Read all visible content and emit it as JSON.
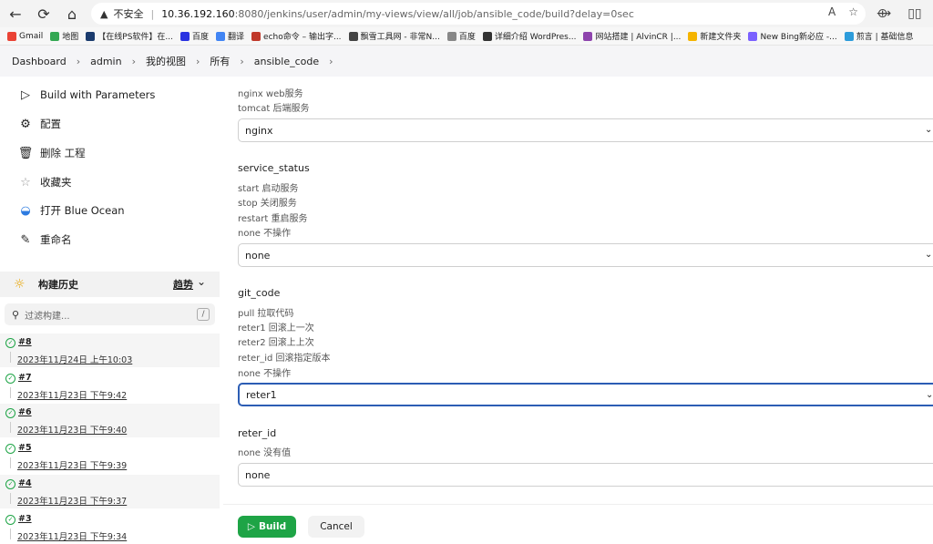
{
  "browser": {
    "back": "←",
    "reload": "⟳",
    "home": "⌂",
    "insecure_label": "不安全",
    "url_host": "10.36.192.160",
    "url_rest": ":8080/jenkins/user/admin/my-views/view/all/job/ansible_code/build?delay=0sec",
    "read_aloud": "A",
    "favorite": "☆",
    "extensions": "⟴",
    "split": "▯▯"
  },
  "bookmarks": [
    {
      "label": "Gmail",
      "color": "#ea4335"
    },
    {
      "label": "地图",
      "color": "#34a853"
    },
    {
      "label": "【在线PS软件】在...",
      "color": "#1b3c6e"
    },
    {
      "label": "百度",
      "color": "#2932e1"
    },
    {
      "label": "翻译",
      "color": "#4285f4"
    },
    {
      "label": "echo命令 – 输出字...",
      "color": "#c0392b"
    },
    {
      "label": "飘雪工具网 - 非常N...",
      "color": "#444444"
    },
    {
      "label": "百度",
      "color": "#888888"
    },
    {
      "label": "详细介绍 WordPres...",
      "color": "#333333"
    },
    {
      "label": "网站搭建 | AlvinCR |...",
      "color": "#8e44ad"
    },
    {
      "label": "新建文件夹",
      "color": "#f5b400"
    },
    {
      "label": "New Bing新必应 -...",
      "color": "#7b61ff"
    },
    {
      "label": "煎言 | 基础信息",
      "color": "#2d9cdb"
    }
  ],
  "breadcrumb": [
    "Dashboard",
    "admin",
    "我的视图",
    "所有",
    "ansible_code"
  ],
  "sidebar": {
    "tasks": [
      {
        "label": "Build with Parameters",
        "icon": "▷"
      },
      {
        "label": "配置",
        "icon": "⚙"
      },
      {
        "label": "删除 工程",
        "icon": "🗑"
      },
      {
        "label": "收藏夹",
        "icon": "☆"
      },
      {
        "label": "打开 Blue Ocean",
        "icon": "◒"
      },
      {
        "label": "重命名",
        "icon": "✎"
      }
    ],
    "history_title": "构建历史",
    "history_icon": "☼",
    "trend_label": "趋势",
    "trend_chevron": "⌄",
    "filter_icon": "⚲",
    "filter_placeholder": "过滤构建...",
    "filter_key": "/",
    "builds_icon": "✓",
    "builds": [
      {
        "num": "#8",
        "date": "2023年11月24日 上午10:03"
      },
      {
        "num": "#7",
        "date": "2023年11月23日 下午9:42"
      },
      {
        "num": "#6",
        "date": "2023年11月23日 下午9:40"
      },
      {
        "num": "#5",
        "date": "2023年11月23日 下午9:39"
      },
      {
        "num": "#4",
        "date": "2023年11月23日 下午9:37"
      },
      {
        "num": "#3",
        "date": "2023年11月23日 下午9:34"
      }
    ]
  },
  "form": {
    "app_desc": [
      "nginx  web服务",
      "tomcat 后端服务"
    ],
    "app_value": "nginx",
    "service_status": {
      "name": "service_status",
      "desc": [
        "start 启动服务",
        "stop  关闭服务",
        "restart  重启服务",
        "none   不操作"
      ],
      "value": "none"
    },
    "git_code": {
      "name": "git_code",
      "desc": [
        "pull  拉取代码",
        "reter1  回滚上一次",
        "reter2  回滚上上次",
        "reter_id  回滚指定版本",
        "none   不操作"
      ],
      "value": "reter1"
    },
    "reter_id": {
      "name": "reter_id",
      "desc": [
        "none 没有值"
      ],
      "value": "none"
    },
    "chevron": "⌄"
  },
  "buttons": {
    "build_icon": "▷",
    "build": "Build",
    "cancel": "Cancel"
  }
}
